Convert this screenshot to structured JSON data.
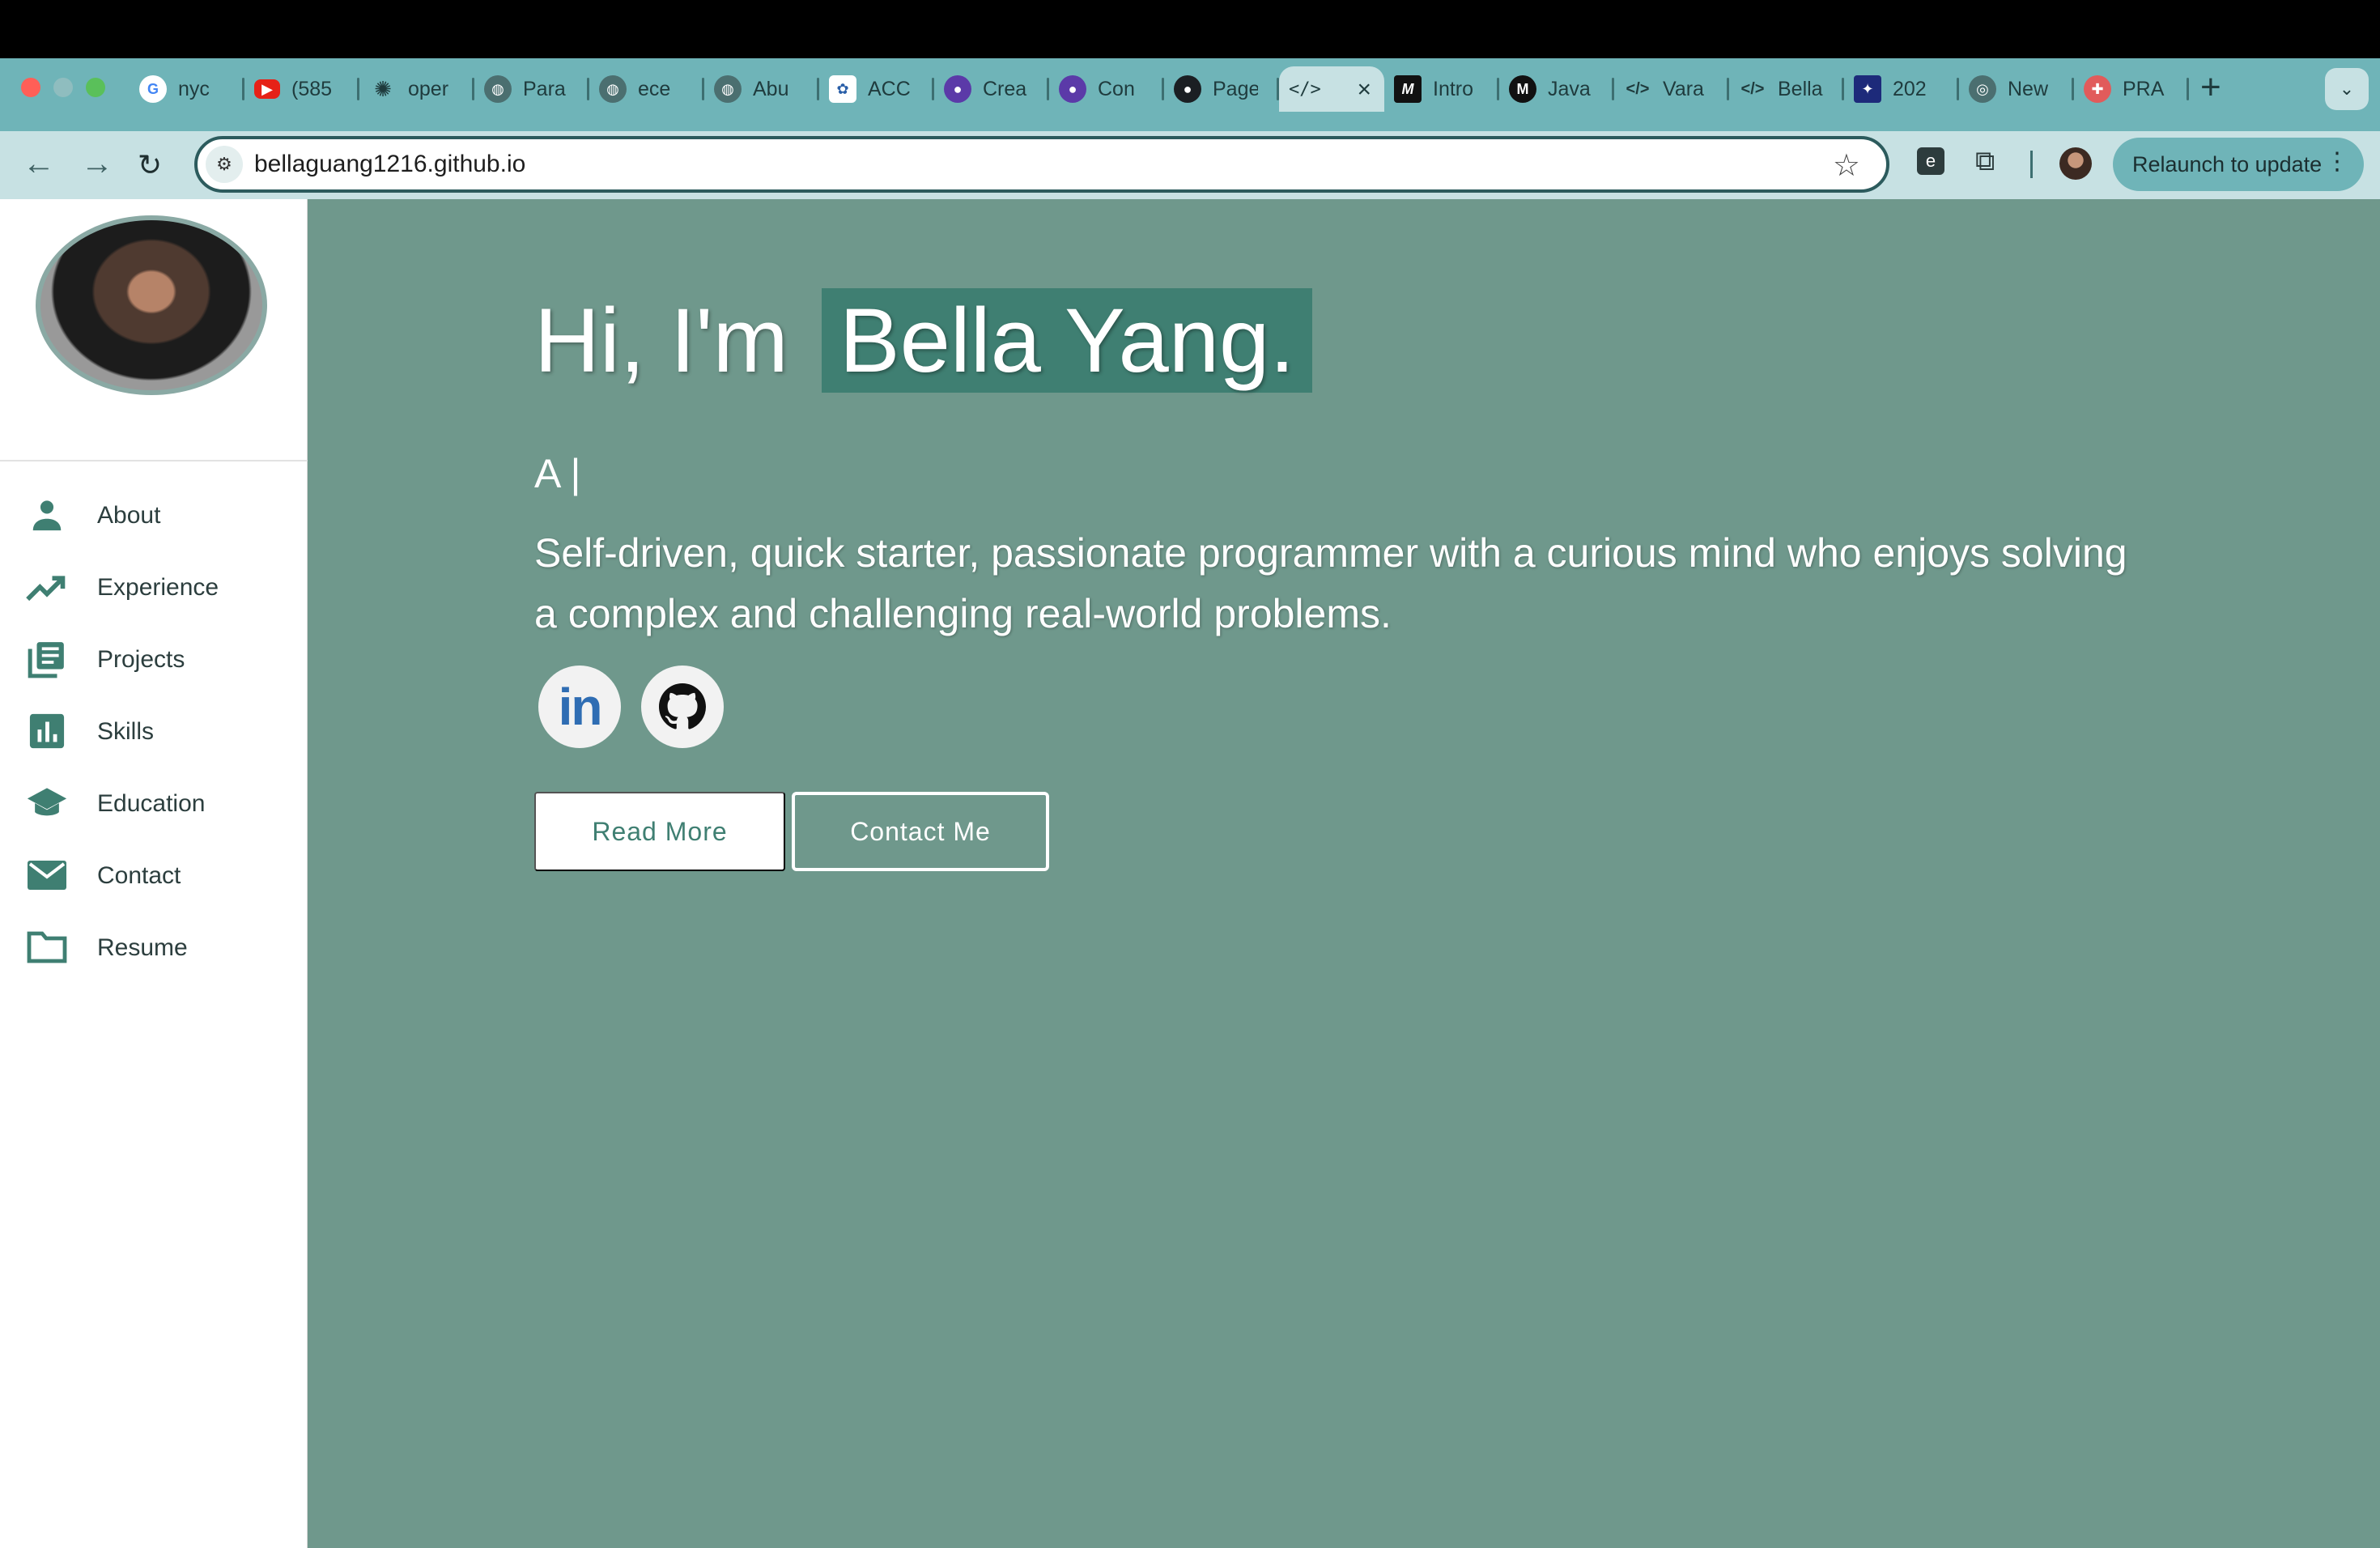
{
  "browser": {
    "tabs": [
      {
        "label": "nyc",
        "icon": "google-icon"
      },
      {
        "label": "(585",
        "icon": "youtube-icon"
      },
      {
        "label": "oper",
        "icon": "openai-icon"
      },
      {
        "label": "Para",
        "icon": "globe-icon"
      },
      {
        "label": "ece",
        "icon": "globe-icon"
      },
      {
        "label": "Abu",
        "icon": "globe-icon"
      },
      {
        "label": "ACC",
        "icon": "acc-icon"
      },
      {
        "label": "Crea",
        "icon": "github-icon"
      },
      {
        "label": "Con",
        "icon": "github-icon"
      },
      {
        "label": "Page",
        "icon": "github-icon"
      },
      {
        "label": "</>",
        "icon": "code-icon",
        "active": true
      },
      {
        "label": "Intro",
        "icon": "m-icon"
      },
      {
        "label": "Java",
        "icon": "m-circle-icon"
      },
      {
        "label": "Vara",
        "icon": "code-icon"
      },
      {
        "label": "Bella",
        "icon": "code-icon"
      },
      {
        "label": "202",
        "icon": "badge-icon"
      },
      {
        "label": "New",
        "icon": "chrome-icon"
      },
      {
        "label": "PRA",
        "icon": "lifebuoy-icon"
      }
    ],
    "url": "bellaguang1216.github.io",
    "relaunch_label": "Relaunch to update"
  },
  "sidebar": {
    "items": [
      {
        "label": "About",
        "icon": "person-icon"
      },
      {
        "label": "Experience",
        "icon": "trending-up-icon"
      },
      {
        "label": "Projects",
        "icon": "library-icon"
      },
      {
        "label": "Skills",
        "icon": "bar-chart-icon"
      },
      {
        "label": "Education",
        "icon": "graduation-cap-icon"
      },
      {
        "label": "Contact",
        "icon": "mail-icon"
      },
      {
        "label": "Resume",
        "icon": "folder-icon"
      }
    ]
  },
  "hero": {
    "greeting": "Hi, I'm",
    "name": "Bella Yang.",
    "typed_text": "A |",
    "bio": "Self-driven, quick starter, passionate programmer with a curious mind who enjoys solving a complex and challenging real-world problems.",
    "linkedin_text": "in",
    "read_more_label": "Read More",
    "contact_label": "Contact Me"
  },
  "colors": {
    "accent": "#3f7f72",
    "main_bg": "#6f988c",
    "chrome": "#6fb4b8"
  }
}
